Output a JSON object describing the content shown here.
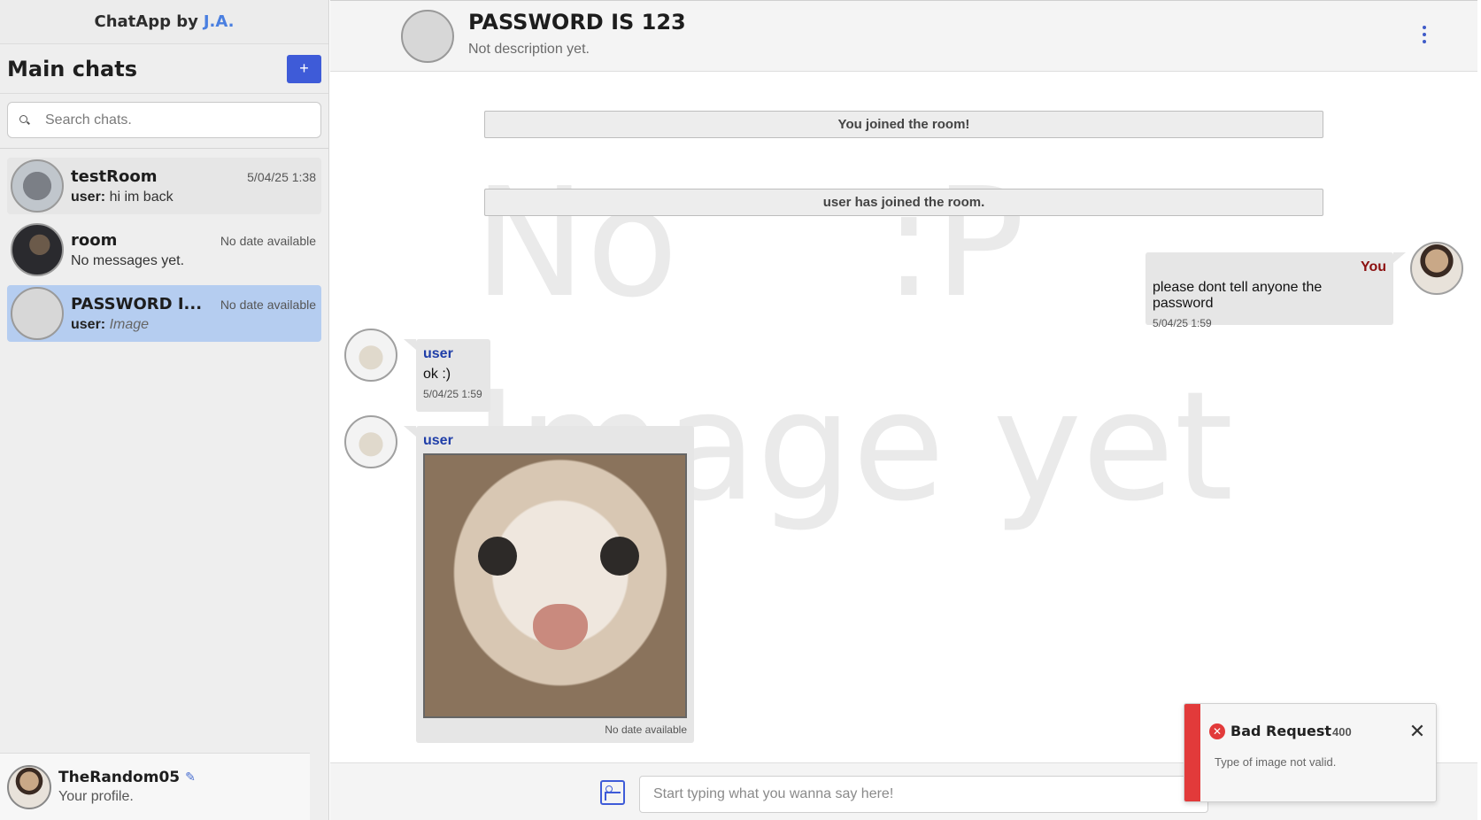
{
  "app": {
    "title": "ChatApp by",
    "author": "J.A."
  },
  "sidebar": {
    "heading": "Main chats",
    "add_label": "+",
    "search_placeholder": "Search chats.",
    "chats": [
      {
        "name": "testRoom",
        "date": "5/04/25 1:38",
        "sender": "user:",
        "last": "hi im back"
      },
      {
        "name": "room",
        "date": "No date available",
        "last": "No messages yet."
      },
      {
        "name": "PASSWORD I...",
        "date": "No date available",
        "sender": "user:",
        "last": "Image"
      }
    ]
  },
  "profile": {
    "name": "TheRandom05",
    "subtitle": "Your profile."
  },
  "room": {
    "title": "PASSWORD IS 123",
    "description": "Not description yet."
  },
  "watermark": {
    "line1": "No",
    "line1b": ":P",
    "line2": "Image yet"
  },
  "messages": {
    "system1": "You joined the room!",
    "system2": "user has joined the room.",
    "mine": {
      "sender": "You",
      "text": "please dont tell anyone the password",
      "time": "5/04/25 1:59"
    },
    "other1": {
      "sender": "user",
      "text": "ok :)",
      "time": "5/04/25 1:59"
    },
    "other2": {
      "sender": "user",
      "time": "No date available"
    }
  },
  "composer": {
    "placeholder": "Start typing what you wanna say here!"
  },
  "toast": {
    "title": "Bad Request",
    "code": "400",
    "message": "Type of image not valid."
  },
  "colors": {
    "accent": "#3e5bd8",
    "active_chat": "#b5cdf0",
    "error": "#e23a3a",
    "own_sender": "#8c1010"
  }
}
